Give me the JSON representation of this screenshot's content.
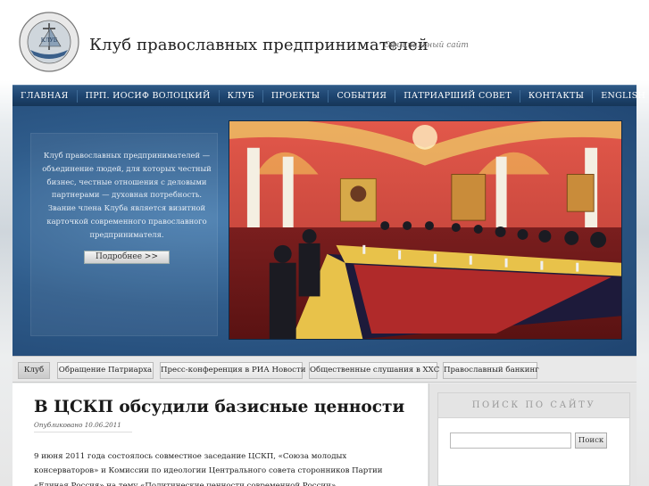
{
  "header": {
    "title": "Клуб православных предпринимателей",
    "tagline": "Официальный сайт",
    "logo_text": "КЛУБ"
  },
  "nav": {
    "items": [
      "ГЛАВНАЯ",
      "ПРП. ИОСИФ ВОЛОЦКИЙ",
      "КЛУБ",
      "ПРОЕКТЫ",
      "СОБЫТИЯ",
      "ПАТРИАРШИЙ СОВЕТ",
      "КОНТАКТЫ",
      "ENGLISH"
    ]
  },
  "banner": {
    "text": "Клуб православных предпринимателей — объединение людей, для которых честный бизнес, честные отношения с деловыми партнерами — духовная потребность. Звание члена Клуба является визитной карточкой современного православного предпринимателя.",
    "more_label": "Подробнее >>"
  },
  "tabs": [
    "Клуб",
    "Обращение Патриарха",
    "Пресс-конференция в РИА Новости",
    "Общественные слушания в ХХС",
    "Православный банкинг"
  ],
  "post": {
    "title": "В ЦСКП обсудили базисные ценности",
    "date": "Опубликовано 10.06.2011",
    "body": "9 июня 2011 года состоялось совместное заседание ЦСКП, «Союза молодых консерваторов» и Комиссии по идеологии Центрального совета сторонников Партии «Единая Россия» на тему «Политические ценности современной России»."
  },
  "search": {
    "heading": "ПОИСК ПО САЙТУ",
    "value": "",
    "button": "Поиск"
  },
  "colors": {
    "nav": "#1e4570",
    "banner": "#2f5c8b",
    "wall": "#c9423a"
  }
}
